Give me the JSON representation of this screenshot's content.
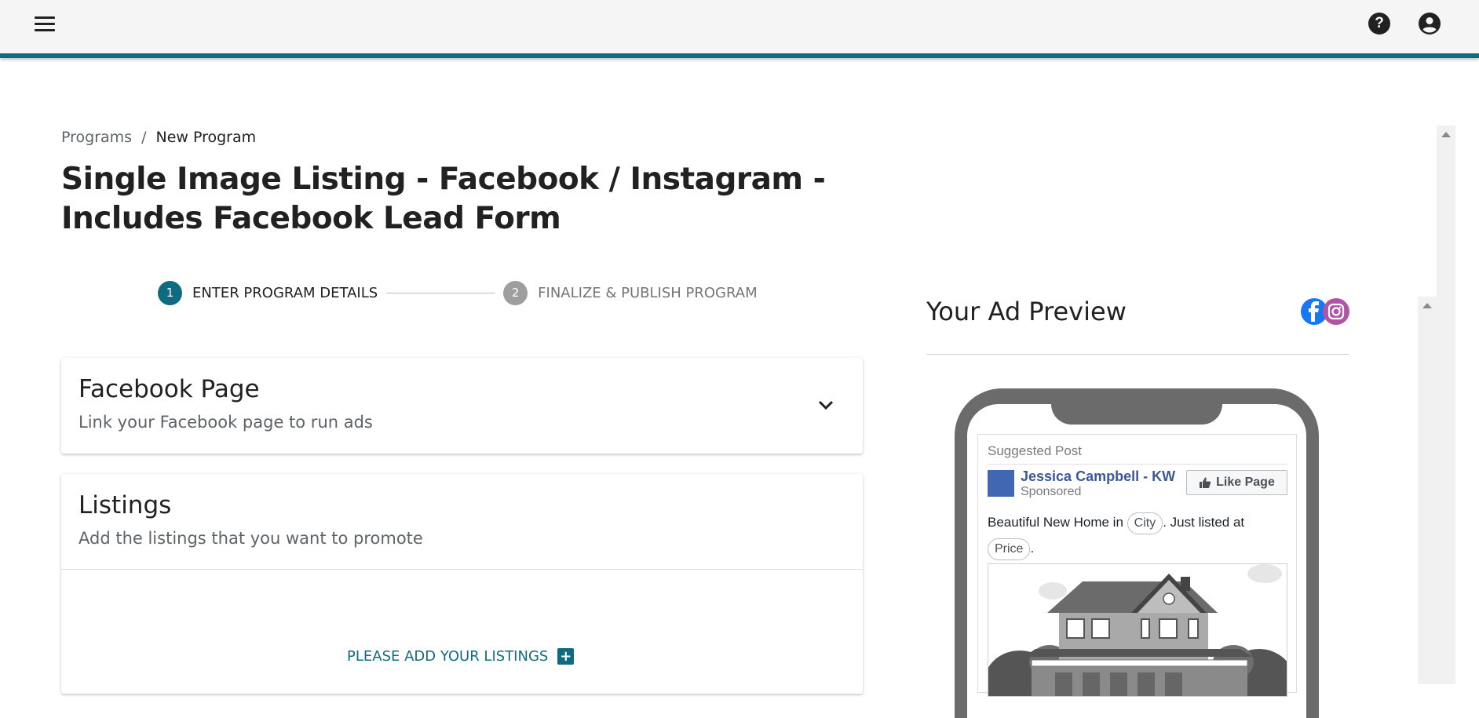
{
  "header": {
    "menu_icon": "hamburger-menu-icon",
    "help_icon": "help-circle-icon",
    "help_glyph": "?",
    "account_icon": "account-circle-icon",
    "accent_color": "#0f6b80"
  },
  "breadcrumb": {
    "items": [
      "Programs",
      "New Program"
    ],
    "separator": "/"
  },
  "page_title": "Single Image Listing - Facebook / Instagram - Includes Facebook Lead Form",
  "stepper": {
    "steps": [
      {
        "number": "1",
        "label": "ENTER PROGRAM DETAILS",
        "active": true
      },
      {
        "number": "2",
        "label": "FINALIZE & PUBLISH PROGRAM",
        "active": false
      }
    ]
  },
  "facebook_page_card": {
    "title": "Facebook Page",
    "subtitle": "Link your Facebook page to run ads",
    "expand_icon": "chevron-down-icon"
  },
  "listings_card": {
    "title": "Listings",
    "subtitle": "Add the listings that you want to promote",
    "add_label": "PLEASE ADD YOUR LISTINGS",
    "add_glyph": "+",
    "add_icon": "plus-box-icon"
  },
  "preview": {
    "title": "Your Ad Preview",
    "platform_icons": [
      "facebook-icon",
      "instagram-icon"
    ],
    "post": {
      "suggested": "Suggested Post",
      "page_name": "Jessica Campbell - KW",
      "sponsored": "Sponsored",
      "like_label": "Like Page",
      "text_before": "Beautiful New Home in",
      "city_pill": "City",
      "text_middle": ". Just listed at",
      "price_pill": "Price",
      "text_end": "."
    }
  }
}
